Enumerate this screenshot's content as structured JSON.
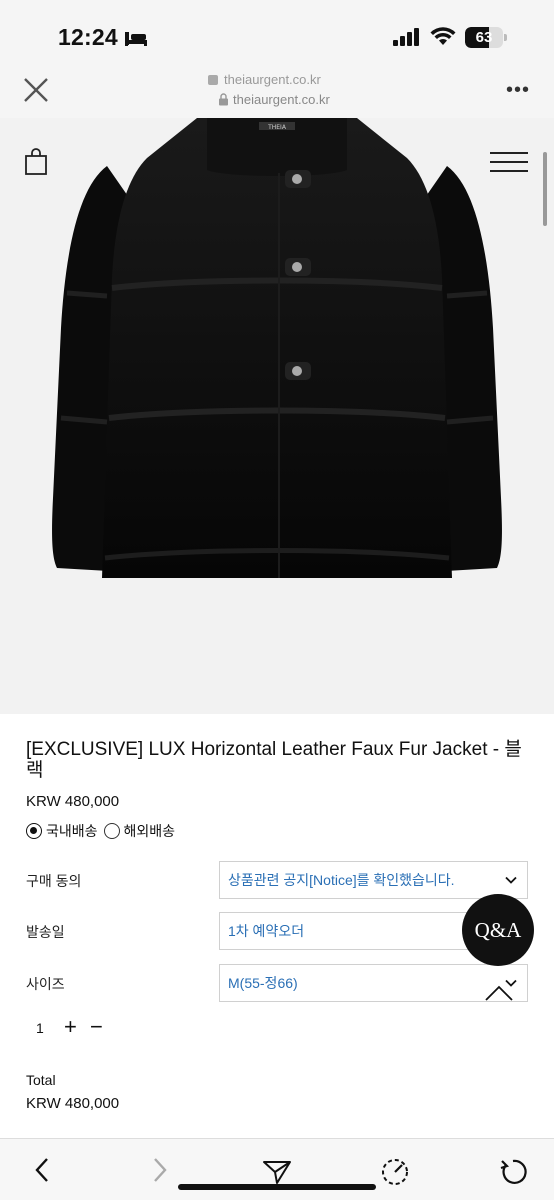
{
  "status_bar": {
    "time": "12:24",
    "battery": "63",
    "battery_level": 0.63
  },
  "browser": {
    "url": "theiaurgent.co.kr",
    "url_ghost": "theiaurgent.co.kr"
  },
  "product": {
    "brand_tag": "THEIA",
    "title": "[EXCLUSIVE] LUX Horizontal Leather Faux Fur Jacket - 블랙",
    "price": "KRW 480,000",
    "shipping_options": [
      "국내배송",
      "해외배송"
    ],
    "shipping_selected": "국내배송"
  },
  "options": [
    {
      "label": "구매 동의",
      "value": "상품관련 공지[Notice]를 확인했습니다."
    },
    {
      "label": "발송일",
      "value": "1차 예약오더"
    },
    {
      "label": "사이즈",
      "value": "M(55-정66)"
    }
  ],
  "quantity": {
    "value": "1",
    "plus": "+",
    "minus": "−"
  },
  "total": {
    "label": "Total",
    "value": "KRW 480,000"
  },
  "qa_button": "Q&A",
  "icons": {
    "close": "close-icon",
    "lock": "lock-icon",
    "more": "more-icon",
    "bag": "shopping-bag-icon",
    "menu": "hamburger-menu-icon",
    "back": "back-icon",
    "forward": "forward-icon",
    "share": "send-icon",
    "speed": "speed-dial-icon",
    "reload": "reload-icon"
  }
}
